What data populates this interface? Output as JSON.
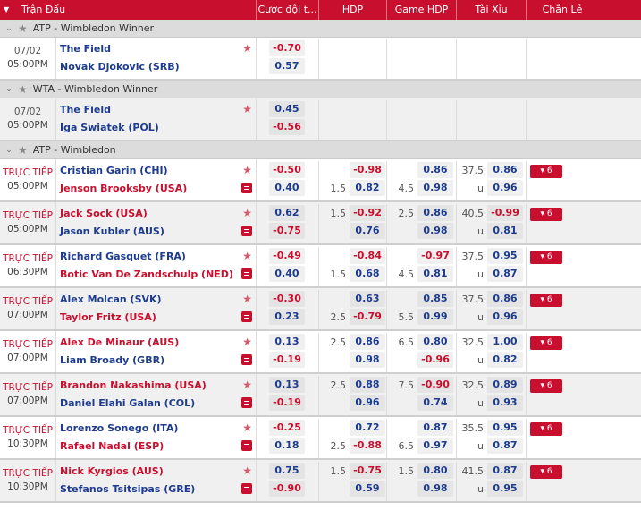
{
  "header": {
    "match": "Trận Đấu",
    "c1": "Cược đội t...",
    "c2": "HDP",
    "c3": "Game HDP",
    "c4": "Tài Xỉu",
    "c5": "Chẵn Lẻ"
  },
  "sections": [
    {
      "league": "ATP - Wimbledon Winner",
      "matches": [
        {
          "date": "07/02",
          "time": "05:00PM",
          "live": false,
          "h": "The Field",
          "a": "Novak Djokovic (SRB)",
          "hRed": false,
          "aRed": false,
          "ml": [
            "-0.70",
            "0.57"
          ],
          "simple": true
        }
      ]
    },
    {
      "league": "WTA - Wimbledon Winner",
      "matches": [
        {
          "date": "07/02",
          "time": "05:00PM",
          "live": false,
          "h": "The Field",
          "a": "Iga Swiatek (POL)",
          "hRed": false,
          "aRed": false,
          "ml": [
            "0.45",
            "-0.56"
          ],
          "simple": true
        }
      ]
    },
    {
      "league": "ATP - Wimbledon",
      "matches": [
        {
          "date": "TRỰC TIẾP",
          "time": "05:00PM",
          "live": true,
          "h": "Cristian Garin (CHI)",
          "a": "Jenson Brooksby (USA)",
          "hRed": false,
          "aRed": true,
          "ml": [
            "-0.50",
            "0.40"
          ],
          "hdpL": [
            "",
            "1.5"
          ],
          "hdp": [
            "-0.98",
            "0.82"
          ],
          "ghL": [
            "",
            "4.5"
          ],
          "gh": [
            "0.86",
            "0.98"
          ],
          "tL": [
            "37.5",
            "u"
          ],
          "t": [
            "0.86",
            "0.96"
          ],
          "more": "6"
        },
        {
          "date": "TRỰC TIẾP",
          "time": "05:00PM",
          "live": true,
          "h": "Jack Sock (USA)",
          "a": "Jason Kubler (AUS)",
          "hRed": true,
          "aRed": false,
          "ml": [
            "0.62",
            "-0.75"
          ],
          "hdpL": [
            "1.5",
            ""
          ],
          "hdp": [
            "-0.92",
            "0.76"
          ],
          "ghL": [
            "2.5",
            ""
          ],
          "gh": [
            "0.86",
            "0.98"
          ],
          "tL": [
            "40.5",
            "u"
          ],
          "t": [
            "-0.99",
            "0.81"
          ],
          "more": "6"
        },
        {
          "date": "TRỰC TIẾP",
          "time": "06:30PM",
          "live": true,
          "h": "Richard Gasquet (FRA)",
          "a": "Botic Van De Zandschulp (NED)",
          "hRed": false,
          "aRed": true,
          "ml": [
            "-0.49",
            "0.40"
          ],
          "hdpL": [
            "",
            "1.5"
          ],
          "hdp": [
            "-0.84",
            "0.68"
          ],
          "ghL": [
            "",
            "4.5"
          ],
          "gh": [
            "-0.97",
            "0.81"
          ],
          "tL": [
            "37.5",
            "u"
          ],
          "t": [
            "0.95",
            "0.87"
          ],
          "more": "6"
        },
        {
          "date": "TRỰC TIẾP",
          "time": "07:00PM",
          "live": true,
          "h": "Alex Molcan (SVK)",
          "a": "Taylor Fritz (USA)",
          "hRed": false,
          "aRed": true,
          "ml": [
            "-0.30",
            "0.23"
          ],
          "hdpL": [
            "",
            "2.5"
          ],
          "hdp": [
            "0.63",
            "-0.79"
          ],
          "ghL": [
            "",
            "5.5"
          ],
          "gh": [
            "0.85",
            "0.99"
          ],
          "tL": [
            "37.5",
            "u"
          ],
          "t": [
            "0.86",
            "0.96"
          ],
          "more": "6"
        },
        {
          "date": "TRỰC TIẾP",
          "time": "07:00PM",
          "live": true,
          "h": "Alex De Minaur (AUS)",
          "a": "Liam Broady (GBR)",
          "hRed": true,
          "aRed": false,
          "ml": [
            "0.13",
            "-0.19"
          ],
          "hdpL": [
            "2.5",
            ""
          ],
          "hdp": [
            "0.86",
            "0.98"
          ],
          "ghL": [
            "6.5",
            ""
          ],
          "gh": [
            "0.80",
            "-0.96"
          ],
          "tL": [
            "32.5",
            "u"
          ],
          "t": [
            "1.00",
            "0.82"
          ],
          "more": "6"
        },
        {
          "date": "TRỰC TIẾP",
          "time": "07:00PM",
          "live": true,
          "h": "Brandon Nakashima (USA)",
          "a": "Daniel Elahi Galan (COL)",
          "hRed": true,
          "aRed": false,
          "ml": [
            "0.13",
            "-0.19"
          ],
          "hdpL": [
            "2.5",
            ""
          ],
          "hdp": [
            "0.88",
            "0.96"
          ],
          "ghL": [
            "7.5",
            ""
          ],
          "gh": [
            "-0.90",
            "0.74"
          ],
          "tL": [
            "32.5",
            "u"
          ],
          "t": [
            "0.89",
            "0.93"
          ],
          "more": "6"
        },
        {
          "date": "TRỰC TIẾP",
          "time": "10:30PM",
          "live": true,
          "h": "Lorenzo Sonego (ITA)",
          "a": "Rafael Nadal (ESP)",
          "hRed": false,
          "aRed": true,
          "ml": [
            "-0.25",
            "0.18"
          ],
          "hdpL": [
            "",
            "2.5"
          ],
          "hdp": [
            "0.72",
            "-0.88"
          ],
          "ghL": [
            "",
            "6.5"
          ],
          "gh": [
            "0.87",
            "0.97"
          ],
          "tL": [
            "35.5",
            "u"
          ],
          "t": [
            "0.95",
            "0.87"
          ],
          "more": "6"
        },
        {
          "date": "TRỰC TIẾP",
          "time": "10:30PM",
          "live": true,
          "h": "Nick Kyrgios (AUS)",
          "a": "Stefanos Tsitsipas (GRE)",
          "hRed": true,
          "aRed": false,
          "ml": [
            "0.75",
            "-0.90"
          ],
          "hdpL": [
            "1.5",
            ""
          ],
          "hdp": [
            "-0.75",
            "0.59"
          ],
          "ghL": [
            "1.5",
            ""
          ],
          "gh": [
            "0.80",
            "0.98"
          ],
          "tL": [
            "41.5",
            "u"
          ],
          "t": [
            "0.87",
            "0.95"
          ],
          "more": "6"
        }
      ]
    }
  ]
}
